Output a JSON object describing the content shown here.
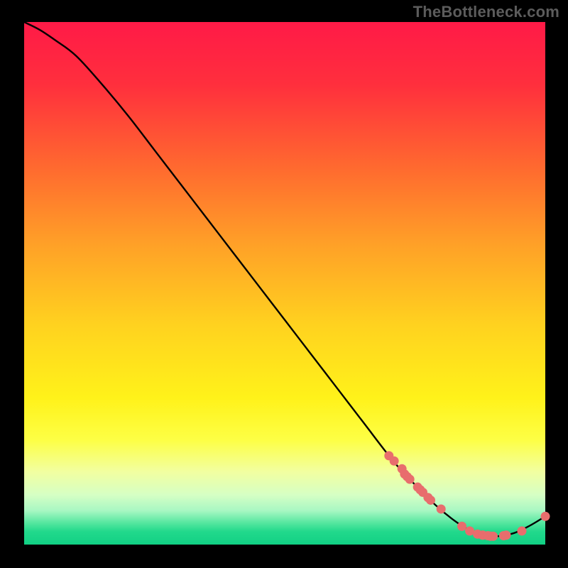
{
  "watermark": "TheBottleneck.com",
  "plot": {
    "inner_x": 34,
    "inner_y": 31,
    "inner_w": 734,
    "inner_h": 736,
    "gradient_stops": [
      {
        "offset": 0.0,
        "color": "#ff1a47"
      },
      {
        "offset": 0.12,
        "color": "#ff2f3d"
      },
      {
        "offset": 0.28,
        "color": "#ff6a2f"
      },
      {
        "offset": 0.43,
        "color": "#ffa227"
      },
      {
        "offset": 0.58,
        "color": "#ffd21f"
      },
      {
        "offset": 0.72,
        "color": "#fff21a"
      },
      {
        "offset": 0.8,
        "color": "#fdff45"
      },
      {
        "offset": 0.86,
        "color": "#f2ffa0"
      },
      {
        "offset": 0.905,
        "color": "#d6ffc4"
      },
      {
        "offset": 0.935,
        "color": "#a8f7c3"
      },
      {
        "offset": 0.958,
        "color": "#57e7a0"
      },
      {
        "offset": 0.975,
        "color": "#22d98c"
      },
      {
        "offset": 1.0,
        "color": "#11d084"
      }
    ],
    "marker_color": "#e86d6d",
    "marker_stroke": "#c94f4f"
  },
  "chart_data": {
    "type": "line",
    "title": "",
    "xlabel": "",
    "ylabel": "",
    "xlim": [
      0,
      100
    ],
    "ylim": [
      0,
      100
    ],
    "comment": "Axis units are normalized 0–100 (no tick labels in source). Curve y is bottleneck-score (high=bad, min near x≈88).",
    "series": [
      {
        "name": "curve",
        "x": [
          0,
          3,
          6,
          10,
          15,
          20,
          25,
          30,
          35,
          40,
          45,
          50,
          55,
          60,
          65,
          70,
          73,
          76,
          79,
          82,
          85,
          88,
          91,
          94,
          97,
          100
        ],
        "y": [
          100,
          98.5,
          96.5,
          93.5,
          88,
          82,
          75.5,
          69,
          62.5,
          56,
          49.5,
          43,
          36.5,
          30,
          23.5,
          17,
          13.5,
          10.5,
          7.5,
          5,
          3,
          1.8,
          1.6,
          2.2,
          3.6,
          5.4
        ]
      }
    ],
    "markers": {
      "comment": "Highlighted sample points (dots) along the curve.",
      "x": [
        70,
        71,
        72.5,
        73,
        73.5,
        74,
        75.5,
        76,
        76.5,
        77.5,
        78,
        80,
        84,
        85.5,
        87,
        88,
        88,
        89,
        89.5,
        90,
        92,
        92.5,
        95.5,
        100
      ],
      "y": [
        17,
        16,
        14.5,
        13.5,
        13,
        12.5,
        11,
        10.5,
        10,
        9,
        8.5,
        6.8,
        3.5,
        2.6,
        2,
        1.8,
        1.8,
        1.7,
        1.6,
        1.6,
        1.7,
        1.8,
        2.6,
        5.4
      ]
    }
  }
}
